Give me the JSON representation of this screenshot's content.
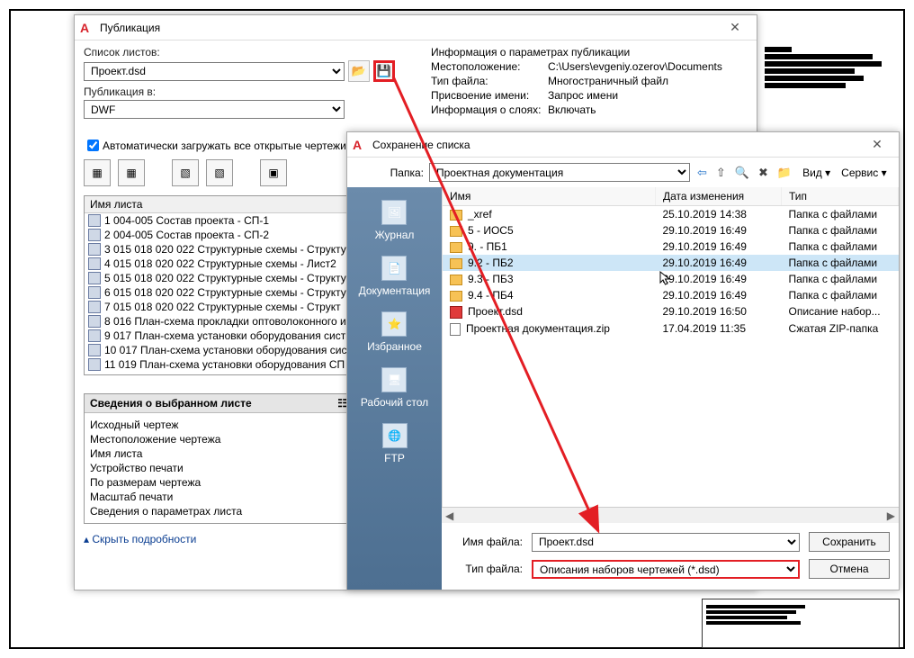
{
  "pub": {
    "title": "Публикация",
    "list_label": "Список листов:",
    "list_value": "Проект.dsd",
    "pub_to_label": "Публикация в:",
    "pub_to_value": "DWF",
    "info_header": "Информация о параметрах публикации",
    "info_location_k": "Местоположение:",
    "info_location_v": "C:\\Users\\evgeniy.ozerov\\Documents",
    "info_filetype_k": "Тип файла:",
    "info_filetype_v": "Многостраничный файл",
    "info_naming_k": "Присвоение имени:",
    "info_naming_v": "Запрос имени",
    "info_layers_k": "Информация о слоях:",
    "info_layers_v": "Включать",
    "checkbox": "Автоматически загружать все открытые чертежи",
    "sheet_hdr": "Имя листа",
    "sheets": [
      "1 004-005 Состав проекта - СП-1",
      "2 004-005 Состав проекта - СП-2",
      "3 015 018 020 022 Структурные схемы - Структу",
      "4 015 018 020 022 Структурные схемы - Лист2",
      "5 015 018 020 022 Структурные схемы - Структу",
      "6 015 018 020 022 Структурные схемы - Структу",
      "7 015 018 020 022 Структурные схемы - Структ",
      "8 016 План-схема прокладки оптоволоконного и",
      "9 017 План-схема установки оборудования сист",
      "10 017 План-схема установки оборудования сис",
      "11 019 План-схема установки оборудования СП"
    ],
    "details_hdr": "Сведения о выбранном листе",
    "details": [
      "Исходный чертеж",
      "Местоположение чертежа",
      "Имя листа",
      "Устройство печати",
      "По размерам чертежа",
      "Масштаб печати",
      "Сведения о параметрах листа"
    ],
    "collapse": "Скрыть подробности",
    "open_icon_title": "Открыть",
    "save_icon_title": "Сохранить"
  },
  "save": {
    "title": "Сохранение списка",
    "folder_label": "Папка:",
    "folder_value": "Проектная документация",
    "view_label": "Вид",
    "service_label": "Сервис",
    "places": [
      "Журнал",
      "Документация",
      "Избранное",
      "Рабочий стол",
      "FTP"
    ],
    "cols": {
      "name": "Имя",
      "date": "Дата изменения",
      "type": "Тип"
    },
    "files": [
      {
        "name": "_xref",
        "date": "25.10.2019 14:38",
        "type": "Папка с файлами",
        "icon": "folder"
      },
      {
        "name": "5 - ИОС5",
        "date": "29.10.2019 16:49",
        "type": "Папка с файлами",
        "icon": "folder"
      },
      {
        "name": "9. - ПБ1",
        "date": "29.10.2019 16:49",
        "type": "Папка с файлами",
        "icon": "folder"
      },
      {
        "name": "9.2 - ПБ2",
        "date": "29.10.2019 16:49",
        "type": "Папка с файлами",
        "icon": "folder",
        "sel": true
      },
      {
        "name": "9.3 - ПБ3",
        "date": "29.10.2019 16:49",
        "type": "Папка с файлами",
        "icon": "folder"
      },
      {
        "name": "9.4 - ПБ4",
        "date": "29.10.2019 16:49",
        "type": "Папка с файлами",
        "icon": "folder"
      },
      {
        "name": "Проект.dsd",
        "date": "29.10.2019 16:50",
        "type": "Описание набор...",
        "icon": "dsd"
      },
      {
        "name": "Проектная документация.zip",
        "date": "17.04.2019 11:35",
        "type": "Сжатая ZIP-папка",
        "icon": "file"
      }
    ],
    "filename_label": "Имя файла:",
    "filename_value": "Проект.dsd",
    "filetype_label": "Тип файла:",
    "filetype_value": "Описания наборов чертежей (*.dsd)",
    "btn_save": "Сохранить",
    "btn_cancel": "Отмена"
  }
}
